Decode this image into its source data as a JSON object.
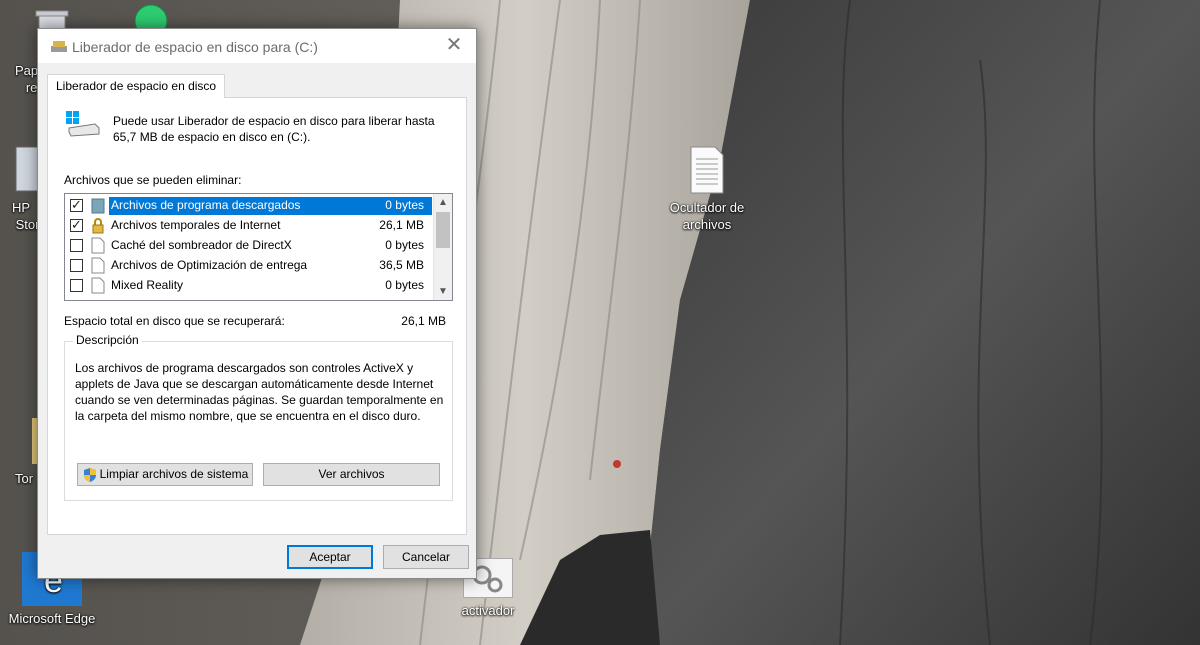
{
  "desktop": {
    "icons": [
      {
        "label": "Papelera de reciclaje",
        "visible_label": "Pap\nre"
      },
      {
        "label": "HP Storage",
        "visible_label": "HP\nStora"
      },
      {
        "label": "Tor",
        "visible_label": "Tor"
      },
      {
        "label": "Microsoft Edge"
      },
      {
        "label": "Ocultador de archivos"
      },
      {
        "label": "activador"
      }
    ]
  },
  "dialog": {
    "title": "Liberador de espacio en disco para  (C:)",
    "close_glyph": "✕",
    "tab_label": "Liberador de espacio en disco",
    "info_text": "Puede usar Liberador de espacio en disco para liberar hasta 65,7 MB de espacio en disco en  (C:).",
    "files_label": "Archivos que se pueden eliminar:",
    "files": [
      {
        "name": "Archivos de programa descargados",
        "size": "0 bytes",
        "checked": true,
        "selected": true,
        "icon": "folder-icon"
      },
      {
        "name": "Archivos temporales de Internet",
        "size": "26,1 MB",
        "checked": true,
        "selected": false,
        "icon": "lock-icon"
      },
      {
        "name": "Caché del sombreador de DirectX",
        "size": "0 bytes",
        "checked": false,
        "selected": false,
        "icon": "file-icon"
      },
      {
        "name": "Archivos de Optimización de entrega",
        "size": "36,5 MB",
        "checked": false,
        "selected": false,
        "icon": "file-icon"
      },
      {
        "name": "Mixed Reality",
        "size": "0 bytes",
        "checked": false,
        "selected": false,
        "icon": "file-icon"
      }
    ],
    "total_label": "Espacio total en disco que se recuperará:",
    "total_value": "26,1 MB",
    "description_legend": "Descripción",
    "description_text": "Los archivos de programa descargados son controles ActiveX y applets de Java que se descargan automáticamente desde Internet cuando se ven determinadas páginas. Se guardan temporalmente en la carpeta del mismo nombre, que se encuentra en el disco duro.",
    "btn_clean": "Limpiar archivos de sistema",
    "btn_view": "Ver archivos",
    "btn_ok": "Aceptar",
    "btn_cancel": "Cancelar"
  },
  "colors": {
    "accent": "#0078d7",
    "dialog_bg": "#f0f0f0"
  }
}
